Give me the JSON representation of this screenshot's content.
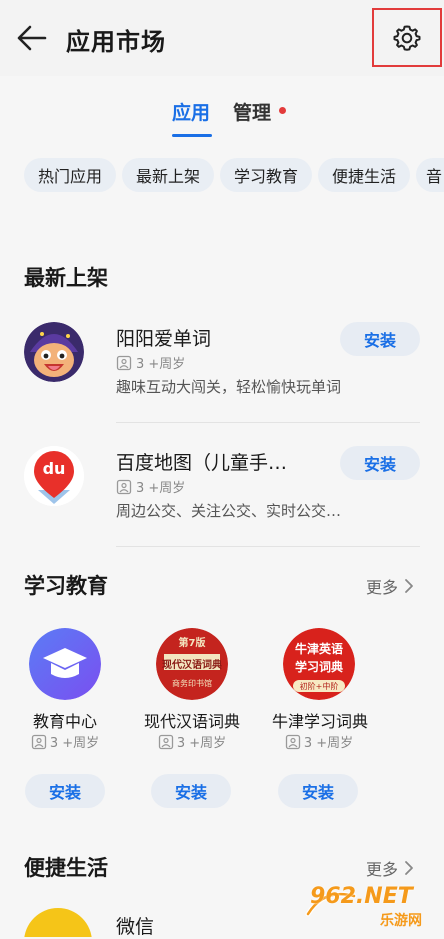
{
  "header": {
    "title": "应用市场"
  },
  "tabs": [
    {
      "label": "应用"
    },
    {
      "label": "管理"
    }
  ],
  "chips": [
    "热门应用",
    "最新上架",
    "学习教育",
    "便捷生活",
    "音"
  ],
  "latest": {
    "title": "最新上架",
    "apps": [
      {
        "name": "阳阳爱单词",
        "age": "3 +周岁",
        "desc": "趣味互动大闯关，轻松愉快玩单词",
        "install": "安装"
      },
      {
        "name": "百度地图（儿童手…",
        "age": "3 +周岁",
        "desc": "周边公交、关注公交、实时公交…",
        "install": "安装",
        "icon_text": "du"
      }
    ]
  },
  "education": {
    "title": "学习教育",
    "more": "更多",
    "apps": [
      {
        "name": "教育中心",
        "age": "3 +周岁",
        "install": "安装"
      },
      {
        "name": "现代汉语词典",
        "age": "3 +周岁",
        "install": "安装",
        "icon_lines": [
          "第7版",
          "现代汉语词典",
          "商务印书馆"
        ]
      },
      {
        "name": "牛津学习词典",
        "age": "3 +周岁",
        "install": "安装",
        "icon_lines": [
          "牛津英语",
          "学习词典",
          "初阶+中阶"
        ]
      }
    ]
  },
  "life": {
    "title": "便捷生活",
    "more": "更多",
    "apps": [
      {
        "name": "微信"
      }
    ]
  },
  "watermark": {
    "brand": "962.NET",
    "sub": "乐游网"
  },
  "colors": {
    "accent": "#1a6fe6",
    "highlight_box": "#e23b3b",
    "chip_bg": "#e9eef4"
  }
}
